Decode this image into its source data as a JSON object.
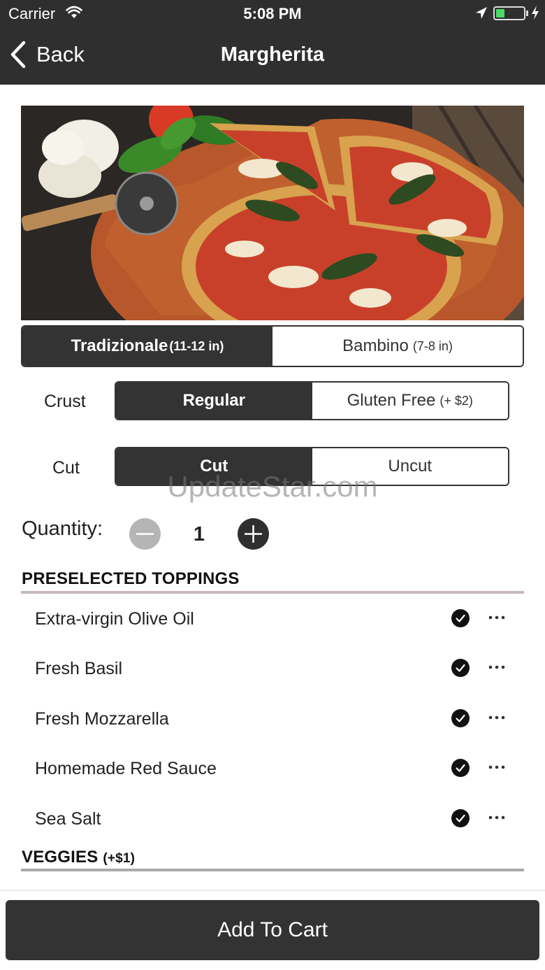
{
  "status_bar": {
    "carrier": "Carrier",
    "time": "5:08 PM",
    "icons": [
      "wifi-icon",
      "location-arrow-icon",
      "battery-icon",
      "charging-icon"
    ]
  },
  "nav": {
    "back_label": "Back",
    "title": "Margherita"
  },
  "hero": {
    "description_icon": "pizza-photo"
  },
  "size": {
    "options": [
      {
        "label": "Tradizionale",
        "sub": "(11-12 in)",
        "selected": true
      },
      {
        "label": "Bambino",
        "sub": "(7-8 in)",
        "selected": false
      }
    ]
  },
  "crust": {
    "label": "Crust",
    "options": [
      {
        "label": "Regular",
        "sub": "",
        "selected": true
      },
      {
        "label": "Gluten Free",
        "sub": "(+ $2)",
        "selected": false
      }
    ]
  },
  "cut": {
    "label": "Cut",
    "options": [
      {
        "label": "Cut",
        "sub": "",
        "selected": true
      },
      {
        "label": "Uncut",
        "sub": "",
        "selected": false
      }
    ]
  },
  "quantity": {
    "label": "Quantity:",
    "value": "1"
  },
  "preselected_toppings": {
    "heading": "PRESELECTED TOPPINGS",
    "items": [
      {
        "label": "Extra-virgin Olive Oil",
        "checked": true
      },
      {
        "label": "Fresh Basil",
        "checked": true
      },
      {
        "label": "Fresh Mozzarella",
        "checked": true
      },
      {
        "label": "Homemade Red Sauce",
        "checked": true
      },
      {
        "label": "Sea Salt",
        "checked": true
      }
    ]
  },
  "veggies": {
    "heading": "VEGGIES",
    "extra": "(+$1)"
  },
  "watermark": "UpdateStar.com",
  "add_to_cart": "Add To Cart",
  "colors": {
    "bar": "#2f2f2f",
    "segment_active": "#333333",
    "toppings_rule": "#c8b7bd",
    "veggies_rule": "#aaaaaa",
    "battery": "#4cd964"
  }
}
